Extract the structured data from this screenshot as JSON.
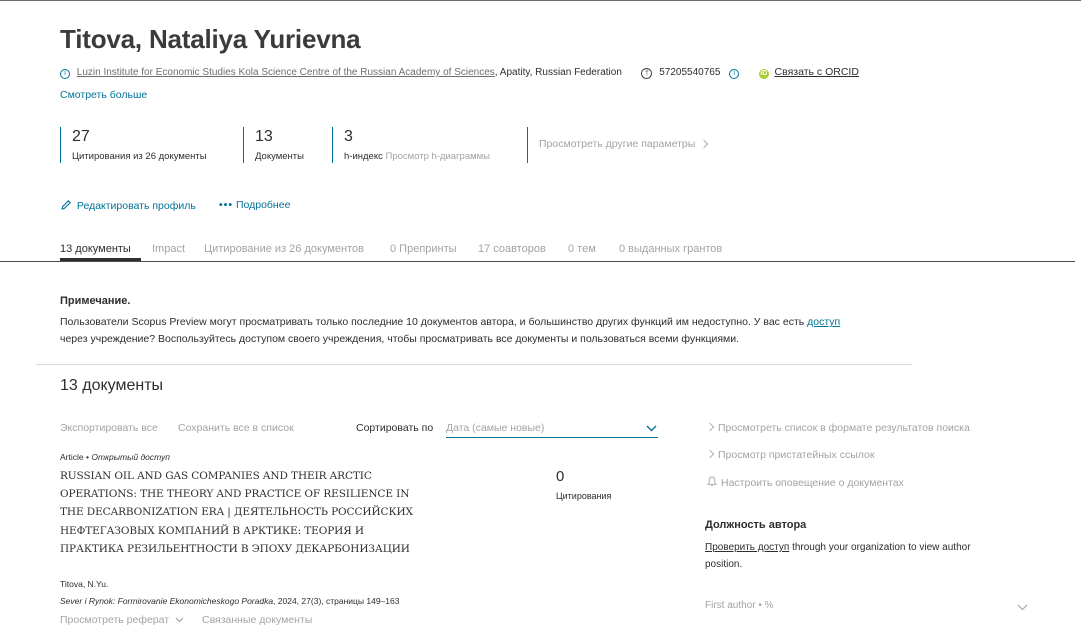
{
  "author": {
    "name": "Titova, Nataliya Yurievna",
    "affiliation_link": "Luzin Institute for Economic Studies Kola Science Centre of the Russian Academy of Sciences",
    "location": ", Apatity, Russian Federation",
    "scopus_id": "57205540765",
    "orcid_link": "Связать с ORCID",
    "see_more": "Смотреть больше"
  },
  "metrics": [
    {
      "value": "27",
      "label": "Цитирования из 26 документы"
    },
    {
      "value": "13",
      "label": "Документы"
    },
    {
      "value": "3",
      "label": "h-индекс",
      "extra": "Просмотр h-диаграммы"
    }
  ],
  "view_more_metrics": "Просмотреть другие параметры",
  "actions": {
    "edit_profile": "Редактировать профиль",
    "more": "Подробнее"
  },
  "tabs": [
    "13 документы",
    "Impact",
    "Цитирование из 26 документов",
    "0 Препринты",
    "17 соавторов",
    "0 тем",
    "0 выданных грантов"
  ],
  "note": {
    "title": "Примечание.",
    "line1_before": "Пользователи Scopus Preview могут просматривать только последние 10 документов автора, и большинство других функций им недоступно. У вас есть",
    "line1_link": "доступ",
    "line2": "через учреждение? Воспользуйтесь доступом своего учреждения, чтобы просматривать все документы и пользоваться всеми функциями."
  },
  "docs": {
    "heading": "13 документы",
    "export_all": "Экспортировать все",
    "save_all": "Сохранить все в список",
    "sort_label": "Сортировать по",
    "sort_value": "Дата (самые новые)"
  },
  "document": {
    "type": "Article",
    "open_access": "Открытый доступ",
    "title": "RUSSIAN OIL AND GAS COMPANIES AND THEIR ARCTIC OPERATIONS: THE THEORY AND PRACTICE OF RESILIENCE IN THE DECARBONIZATION ERA | ДЕЯТЕЛЬНОСТЬ РОССИЙСКИХ НЕФТЕГАЗОВЫХ КОМПАНИЙ В АРКТИКЕ: ТЕОРИЯ И ПРАКТИКА РЕЗИЛЬЕНТНОСТИ В ЭПОХУ ДЕКАРБОНИЗАЦИИ",
    "authors": "Titova, N.Yu.",
    "journal": "Sever i Rynok: Formirovanie Ekonomicheskogo Poradka",
    "journal_details": ", 2024, 27(3), страницы 149–163",
    "citations": "0",
    "citations_label": "Цитирования",
    "view_abstract": "Просмотреть реферат",
    "related": "Связанные документы"
  },
  "sidebar": {
    "links": [
      "Просмотреть список в формате результатов поиска",
      "Просмотр пристатейных ссылок",
      "Настроить оповещение о документах"
    ],
    "position_title": "Должность автора",
    "check_access": "Проверить доступ",
    "position_text": " through your organization to view author position.",
    "first_author": "First author",
    "percent": "%"
  },
  "colors": {
    "link": "#007398",
    "orcid": "#a6ce39",
    "muted": "#a3a3a3"
  }
}
